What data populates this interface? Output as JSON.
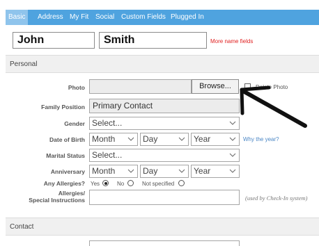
{
  "tabs": [
    {
      "label": "Basic",
      "active": true
    },
    {
      "label": "Address",
      "active": false
    },
    {
      "label": "My Fit",
      "active": false
    },
    {
      "label": "Social",
      "active": false
    },
    {
      "label": "Custom Fields",
      "active": false
    },
    {
      "label": "Plugged In",
      "active": false
    }
  ],
  "name": {
    "first_value": "John",
    "last_value": "Smith",
    "more_link": "More name fields"
  },
  "sections": {
    "personal": "Personal",
    "contact": "Contact"
  },
  "photo": {
    "label": "Photo",
    "browse_label": "Browse...",
    "delete_label": "Delete Photo"
  },
  "family_position": {
    "label": "Family Position",
    "value": "Primary Contact"
  },
  "gender": {
    "label": "Gender",
    "value": "Select..."
  },
  "dob": {
    "label": "Date of Birth",
    "month": "Month",
    "day": "Day",
    "year": "Year",
    "why_link": "Why the year?"
  },
  "marital": {
    "label": "Marital Status",
    "value": "Select..."
  },
  "anniversary": {
    "label": "Anniversary",
    "month": "Month",
    "day": "Day",
    "year": "Year"
  },
  "allergies": {
    "label": "Any Allergies?",
    "options": [
      "Yes",
      "No",
      "Not specified"
    ],
    "selected": "Yes"
  },
  "instructions": {
    "label_line1": "Allergies/",
    "label_line2": "Special Instructions",
    "note": "(used by Check-In system)"
  },
  "colors": {
    "tab_bar": "#4fa3df",
    "tab_active": "#8fc4ec",
    "more_link": "#e02020",
    "why_link": "#4a86c5"
  },
  "icons": {
    "dropdown": "chevron-down-icon",
    "annotation": "arrow-pointer-icon"
  }
}
